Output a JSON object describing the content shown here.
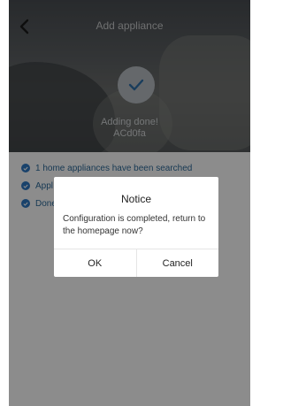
{
  "header": {
    "title": "Add appliance",
    "back_icon": "chevron-left-icon"
  },
  "status": {
    "icon": "check-icon",
    "line1": "Adding done!",
    "line2": "ACd0fa"
  },
  "steps": [
    {
      "label": "1 home appliances have been searched",
      "icon": "check-circle-icon"
    },
    {
      "label": "Appl",
      "icon": "check-circle-icon"
    },
    {
      "label": "Done",
      "icon": "check-circle-icon"
    }
  ],
  "dialog": {
    "title": "Notice",
    "message": "Configuration is completed, return to the homepage now?",
    "ok_label": "OK",
    "cancel_label": "Cancel"
  },
  "colors": {
    "accent": "#2f78c4",
    "overlay": "rgba(0,0,0,0.45)"
  }
}
